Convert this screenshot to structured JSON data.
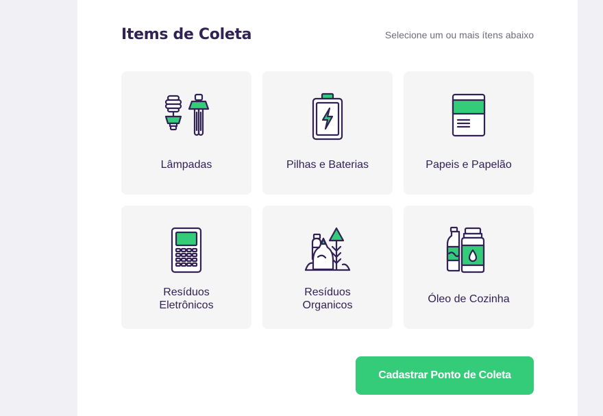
{
  "section": {
    "title": "Items de Coleta",
    "hint": "Selecione um ou mais ítens abaixo"
  },
  "items": [
    {
      "label": "Lâmpadas",
      "icon": "lamps-icon"
    },
    {
      "label": "Pilhas e Baterias",
      "icon": "battery-icon"
    },
    {
      "label": "Papeis e Papelão",
      "icon": "paper-icon"
    },
    {
      "label": "Resíduos Eletrônicos",
      "line1": "Resíduos",
      "line2": "Eletrônicos",
      "icon": "electronics-icon"
    },
    {
      "label": "Resíduos Organicos",
      "line1": "Resíduos",
      "line2": "Organicos",
      "icon": "organic-icon"
    },
    {
      "label": "Óleo de Cozinha",
      "icon": "cooking-oil-icon"
    }
  ],
  "submit_label": "Cadastrar Ponto de Coleta",
  "colors": {
    "primary": "#34CB79",
    "title": "#322153",
    "text": "#6C6C80",
    "card": "#F5F5F5",
    "background": "#F0F0F5"
  }
}
